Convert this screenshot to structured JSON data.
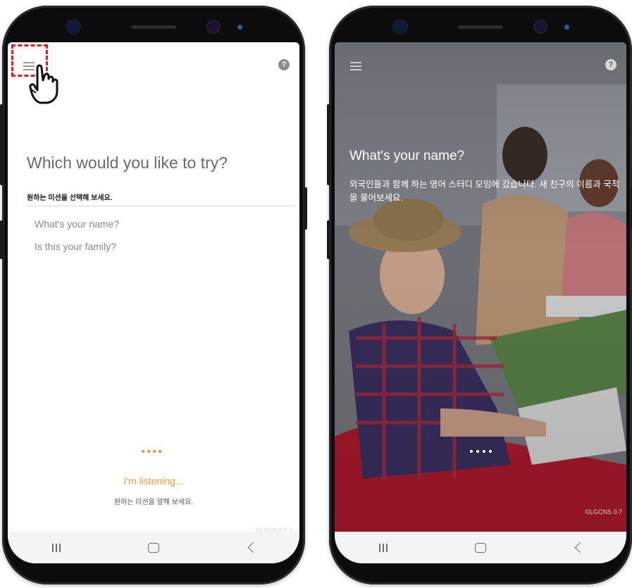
{
  "left_screen": {
    "title": "Which would you like to try?",
    "subtitle": "원하는 미션을 선택해 보세요.",
    "missions": [
      {
        "label": "What's your name?"
      },
      {
        "label": "Is this your family?"
      }
    ],
    "status": "I'm listening...",
    "status_sub": "원하는 미션을 말해 보세요.",
    "copyright": "©LGCNS 0.7",
    "menu_icon": "hamburger-icon",
    "help_icon": "help-icon",
    "help_glyph": "?",
    "highlight_color": "#e31e1e",
    "accent_color": "#f28a2a"
  },
  "right_screen": {
    "title": "What's your name?",
    "description": "외국인들과 함께 하는 영어 스터디 모임에 갔습니다. 새 친구의 이름과 국적을 물어보세요.",
    "copyright": "©LGCNS 0.7",
    "menu_icon": "hamburger-icon",
    "help_icon": "help-icon",
    "help_glyph": "?"
  },
  "navbar": {
    "buttons": [
      "recents-icon",
      "home-icon",
      "back-icon"
    ]
  }
}
